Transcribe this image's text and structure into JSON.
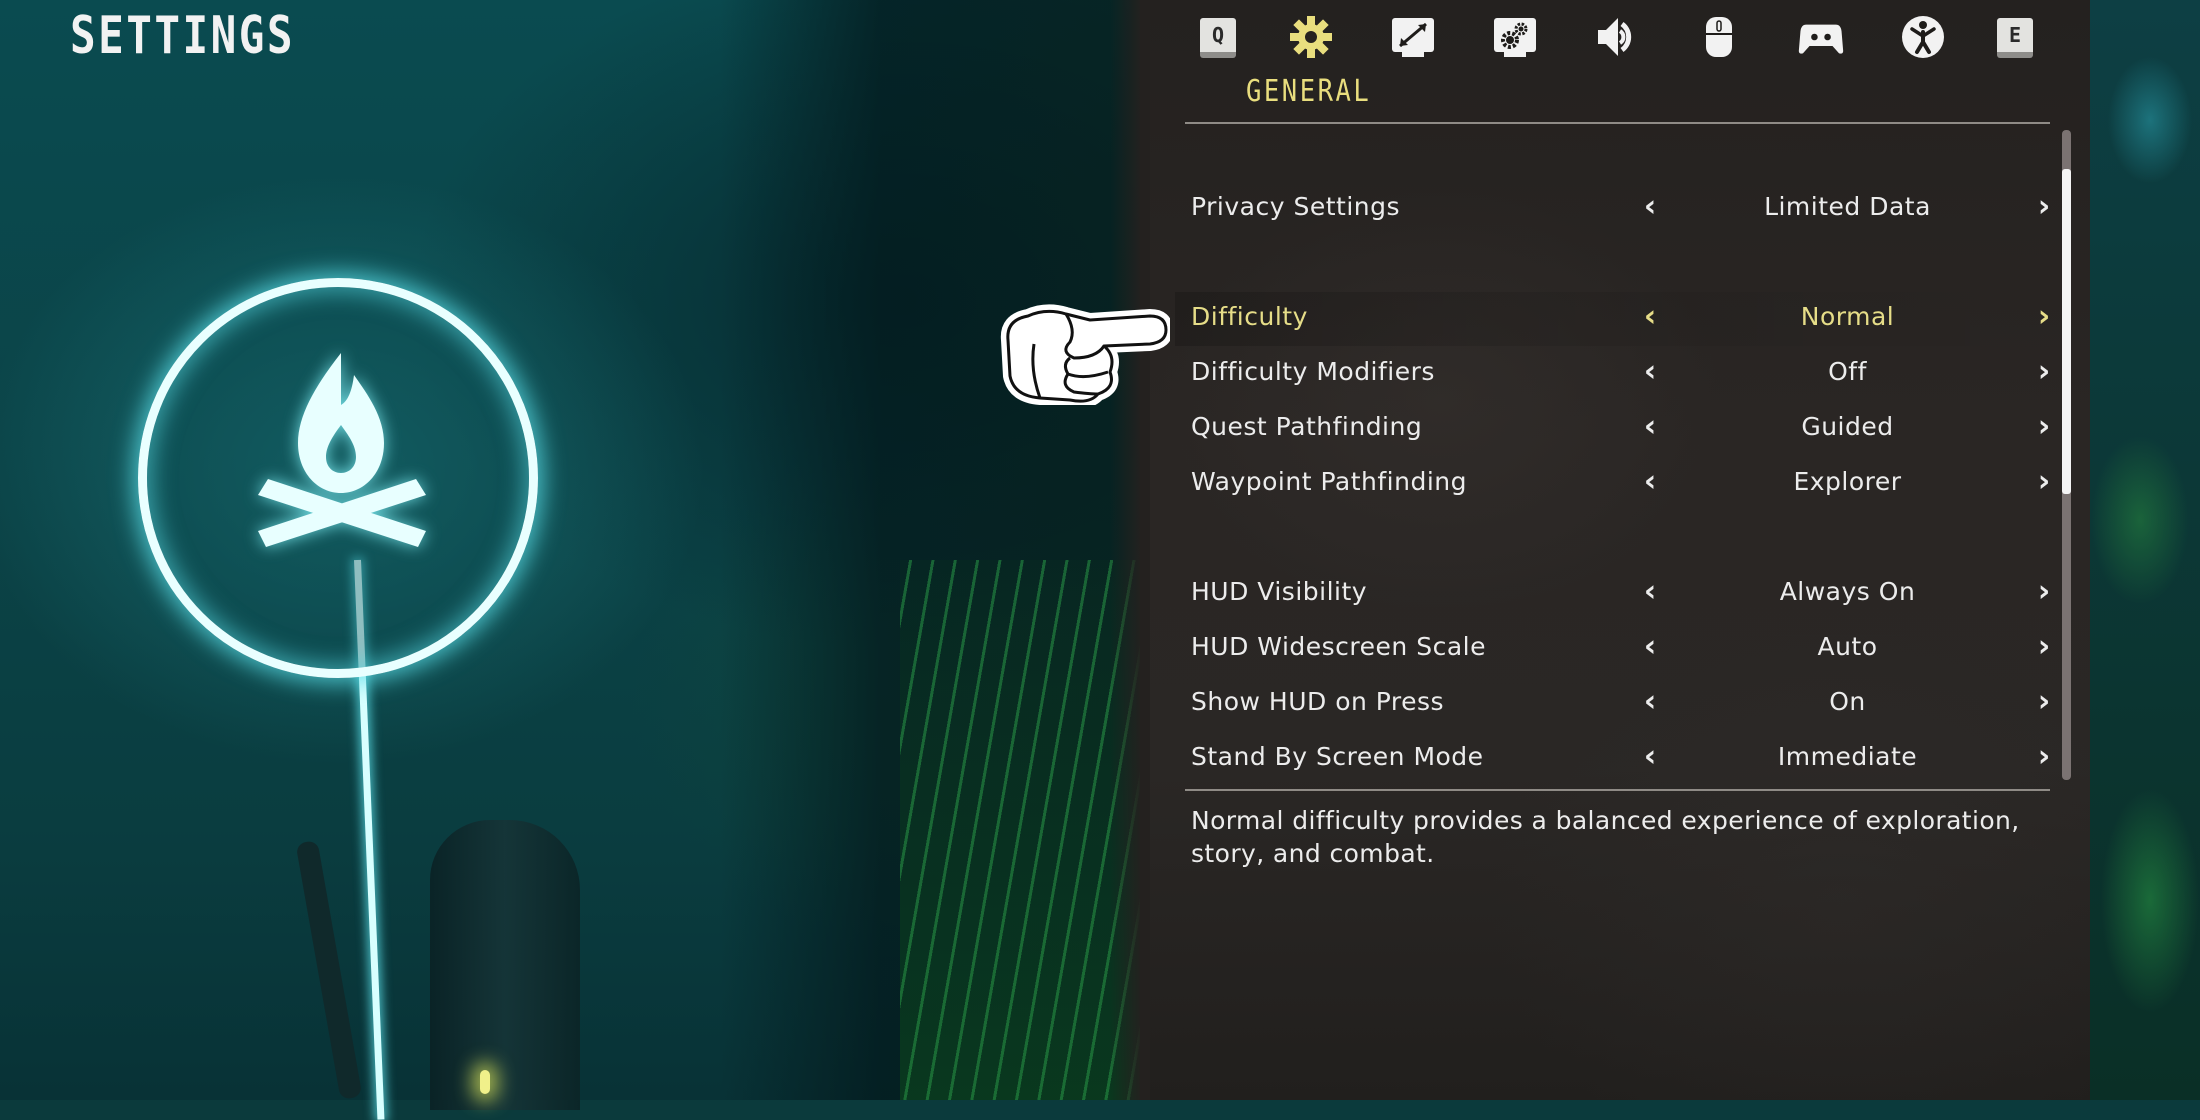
{
  "page": {
    "title": "SETTINGS"
  },
  "tabs": {
    "active_label": "GENERAL",
    "active_index": 1,
    "items": [
      {
        "id": "prev-key",
        "type": "key",
        "key": "Q",
        "icon": "q-key-icon"
      },
      {
        "id": "general",
        "type": "icon",
        "icon": "gear-icon",
        "label": "GENERAL"
      },
      {
        "id": "display",
        "type": "icon",
        "icon": "screen-resize-icon"
      },
      {
        "id": "graphics",
        "type": "icon",
        "icon": "screen-gears-icon"
      },
      {
        "id": "audio",
        "type": "icon",
        "icon": "speaker-icon"
      },
      {
        "id": "mouse-keyboard",
        "type": "icon",
        "icon": "mouse-icon"
      },
      {
        "id": "controller",
        "type": "icon",
        "icon": "gamepad-icon"
      },
      {
        "id": "accessibility",
        "type": "icon",
        "icon": "accessibility-icon"
      },
      {
        "id": "next-key",
        "type": "key",
        "key": "E",
        "icon": "e-key-icon"
      }
    ]
  },
  "settings": [
    {
      "label": "Privacy Settings",
      "value": "Limited Data"
    },
    {
      "label": "Difficulty",
      "value": "Normal",
      "selected": true
    },
    {
      "label": "Difficulty Modifiers",
      "value": "Off"
    },
    {
      "label": "Quest Pathfinding",
      "value": "Guided"
    },
    {
      "label": "Waypoint Pathfinding",
      "value": "Explorer"
    },
    {
      "label": "HUD Visibility",
      "value": "Always On"
    },
    {
      "label": "HUD Widescreen Scale",
      "value": "Auto"
    },
    {
      "label": "Show HUD on Press",
      "value": "On"
    },
    {
      "label": "Stand By Screen Mode",
      "value": "Immediate"
    }
  ],
  "arrows": {
    "left": "‹",
    "right": "›"
  },
  "description": "Normal difficulty provides a balanced experience of exploration, story, and combat.",
  "scrollbar": {
    "thumb_start_fraction": 0.06,
    "thumb_size_fraction": 0.5
  },
  "colors": {
    "accent_selected": "#e6dd88",
    "tab_active": "#e9de7e",
    "text": "#ececec",
    "panel_bg": "#272321",
    "beacon_glow": "#7fe6ec"
  }
}
